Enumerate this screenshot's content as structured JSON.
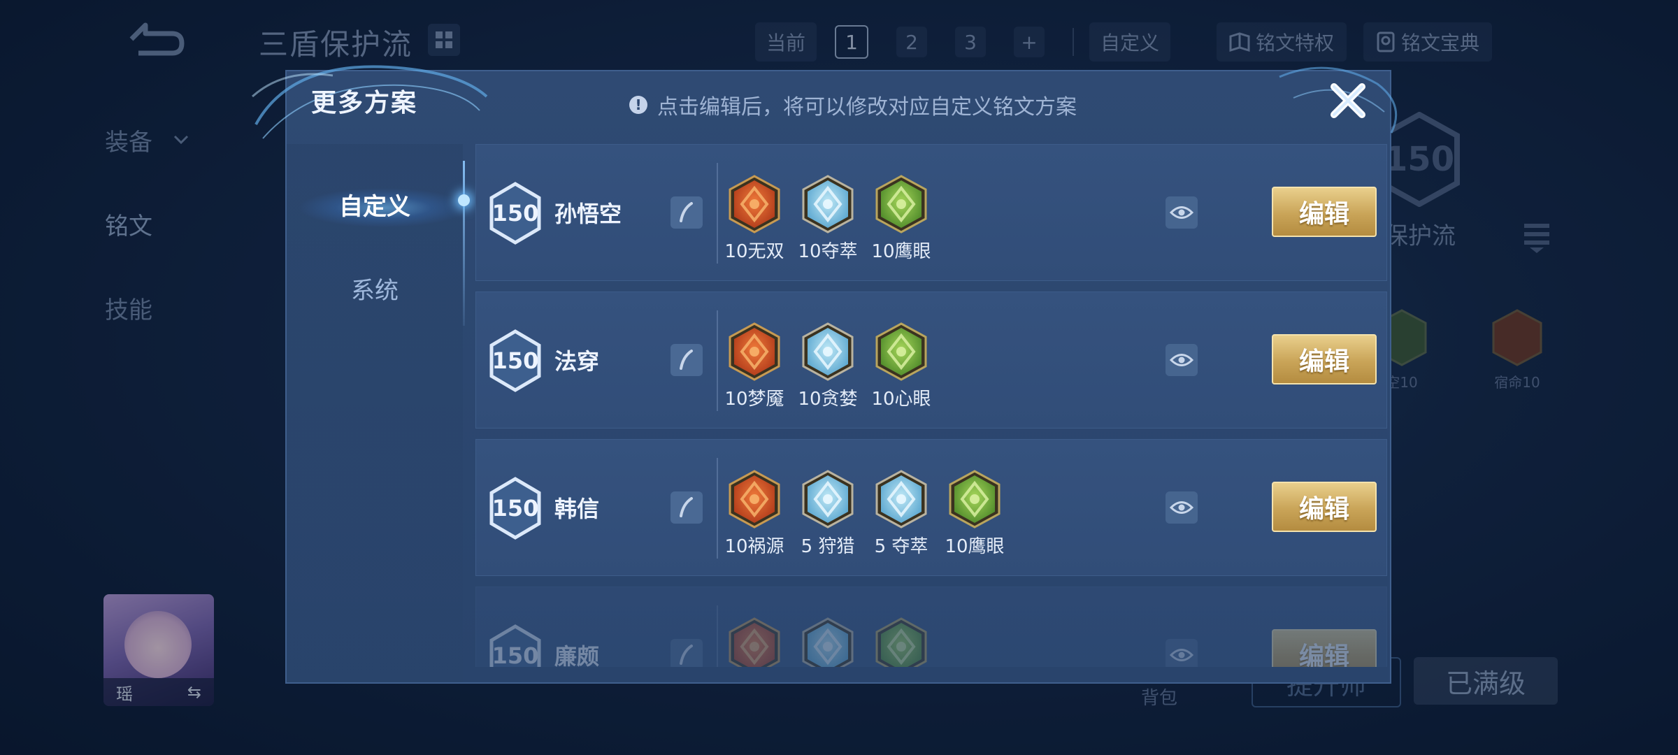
{
  "background": {
    "page_title": "三盾保护流",
    "top_tabs": {
      "current_label": "当前",
      "pages": [
        "1",
        "2",
        "3"
      ],
      "add_label": "+",
      "custom_label": "自定义",
      "privilege_label": "铭文特权",
      "codex_label": "铭文宝典"
    },
    "left_nav": {
      "equipment": "装备",
      "inscription": "铭文",
      "skills": "技能"
    },
    "hero": {
      "name": "瑶",
      "swap_glyph": "⇆"
    },
    "right_panel": {
      "level": "150",
      "plan_name": "保护流",
      "rune_a": "空10",
      "rune_b": "宿命10"
    },
    "bag_label": "背包",
    "upgrade_button": "提升师",
    "maxed_button": "已满级"
  },
  "modal": {
    "title": "更多方案",
    "hint": "点击编辑后，将可以修改对应自定义铭文方案",
    "tabs": [
      {
        "label": "自定义",
        "active": true
      },
      {
        "label": "系统",
        "active": false
      }
    ],
    "edit_label": "编辑",
    "plans": [
      {
        "level": "150",
        "name": "孙悟空",
        "runes": [
          {
            "label": "10无双",
            "color": "red"
          },
          {
            "label": "10夺萃",
            "color": "blue"
          },
          {
            "label": "10鹰眼",
            "color": "green"
          }
        ]
      },
      {
        "level": "150",
        "name": "法穿",
        "runes": [
          {
            "label": "10梦魇",
            "color": "red"
          },
          {
            "label": "10贪婪",
            "color": "blue"
          },
          {
            "label": "10心眼",
            "color": "green"
          }
        ]
      },
      {
        "level": "150",
        "name": "韩信",
        "runes": [
          {
            "label": "10祸源",
            "color": "red"
          },
          {
            "label": "5 狩猎",
            "color": "blue"
          },
          {
            "label": "5 夺萃",
            "color": "blue"
          },
          {
            "label": "10鹰眼",
            "color": "green"
          }
        ]
      },
      {
        "level": "150",
        "name": "廉颇",
        "runes": [
          {
            "color": "red"
          },
          {
            "color": "blue"
          },
          {
            "color": "green"
          }
        ]
      }
    ]
  },
  "colors": {
    "modal_bg": "#2f4a73",
    "gold_button": "#c9a458",
    "rune_red": "#d4572a",
    "rune_blue": "#7fc6e6",
    "rune_green": "#6fae3c"
  }
}
